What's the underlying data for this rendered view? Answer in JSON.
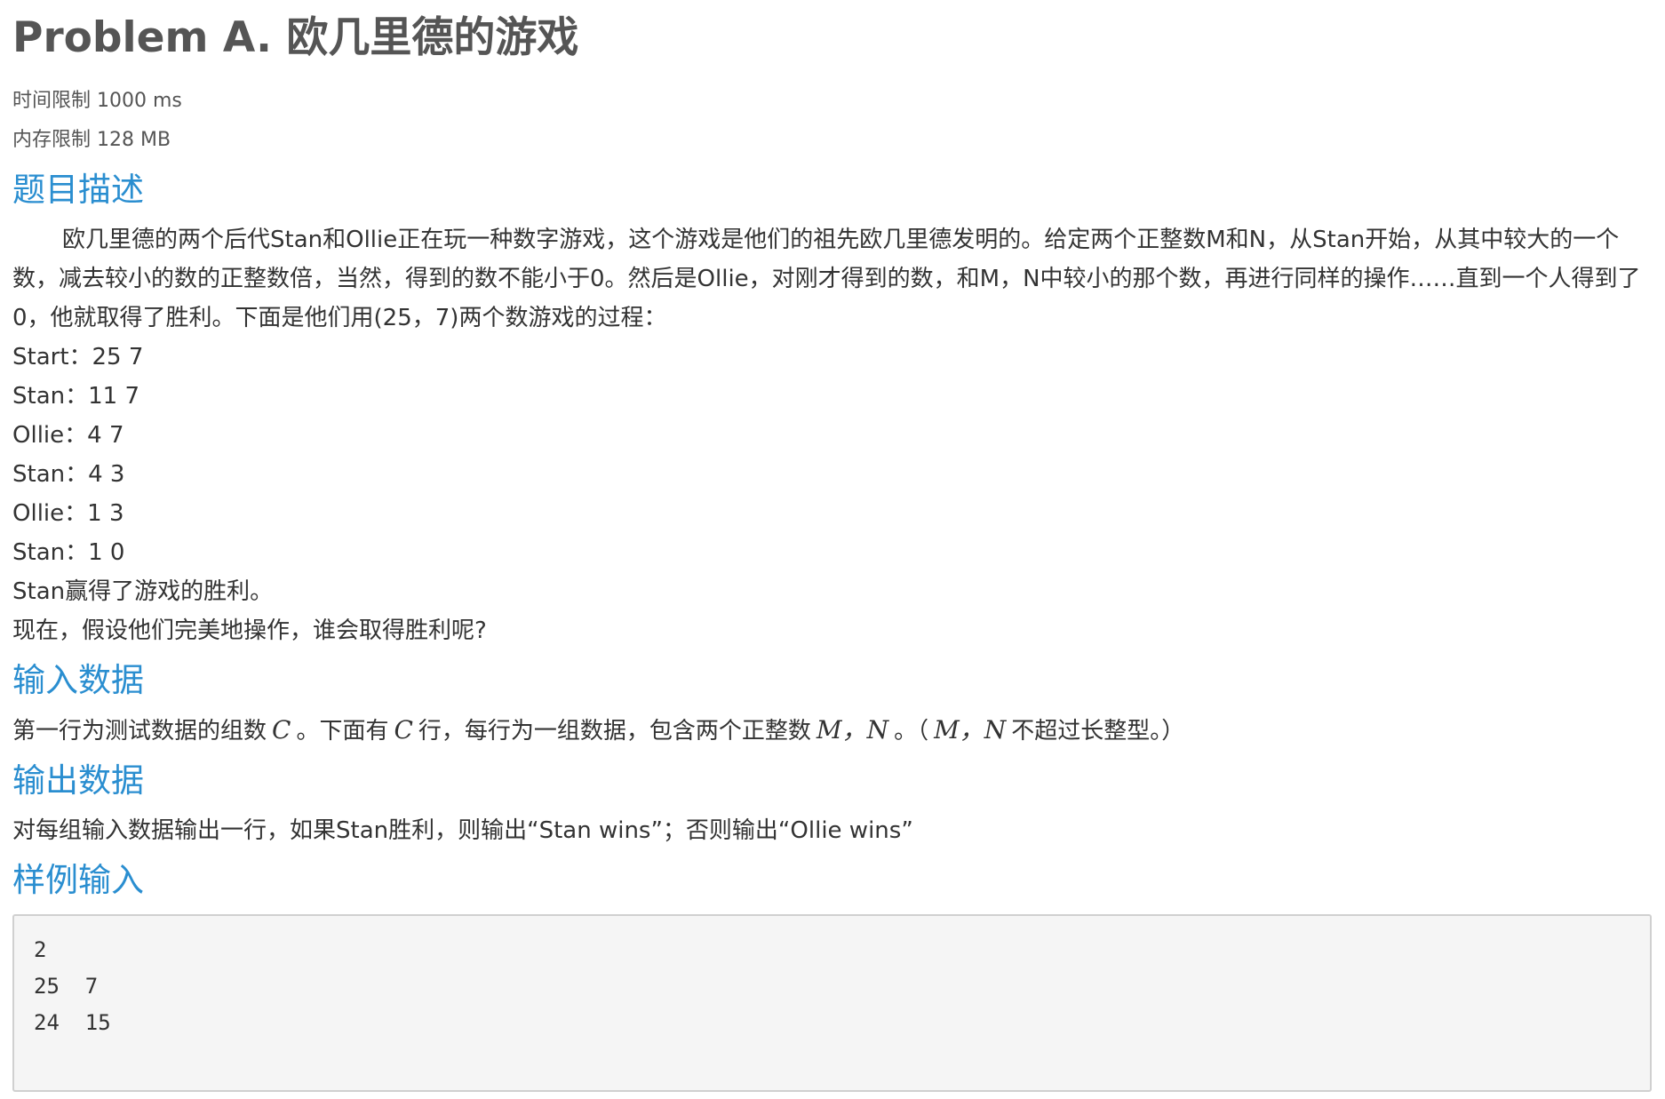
{
  "title": "Problem A. 欧几里德的游戏",
  "limits": {
    "time": "时间限制 1000 ms",
    "memory": "内存限制 128 MB"
  },
  "sections": {
    "description": {
      "heading": "题目描述",
      "paragraph": "欧几里德的两个后代Stan和Ollie正在玩一种数字游戏，这个游戏是他们的祖先欧几里德发明的。给定两个正整数M和N，从Stan开始，从其中较大的一个数，减去较小的数的正整数倍，当然，得到的数不能小于0。然后是Ollie，对刚才得到的数，和M，N中较小的那个数，再进行同样的操作……直到一个人得到了0，他就取得了胜利。下面是他们用(25，7)两个数游戏的过程：",
      "steps": [
        "Start：25 7",
        "Stan：11 7",
        "Ollie：4 7",
        "Stan：4 3",
        "Ollie：1 3",
        "Stan：1 0"
      ],
      "result": "Stan赢得了游戏的胜利。",
      "question": "现在，假设他们完美地操作，谁会取得胜利呢?"
    },
    "input": {
      "heading": "输入数据",
      "text_1": "第一行为测试数据的组数",
      "var_c": "C",
      "text_2": "。下面有",
      "text_3": "行，每行为一组数据，包含两个正整数",
      "var_mn": "M，N",
      "text_4": "。（",
      "text_5": "不超过长整型。）"
    },
    "output": {
      "heading": "输出数据",
      "text": "对每组输入数据输出一行，如果Stan胜利，则输出“Stan wins”；否则输出“Ollie wins”"
    },
    "sample_input": {
      "heading": "样例输入",
      "lines": [
        "2",
        "25  7",
        "24  15"
      ]
    }
  }
}
